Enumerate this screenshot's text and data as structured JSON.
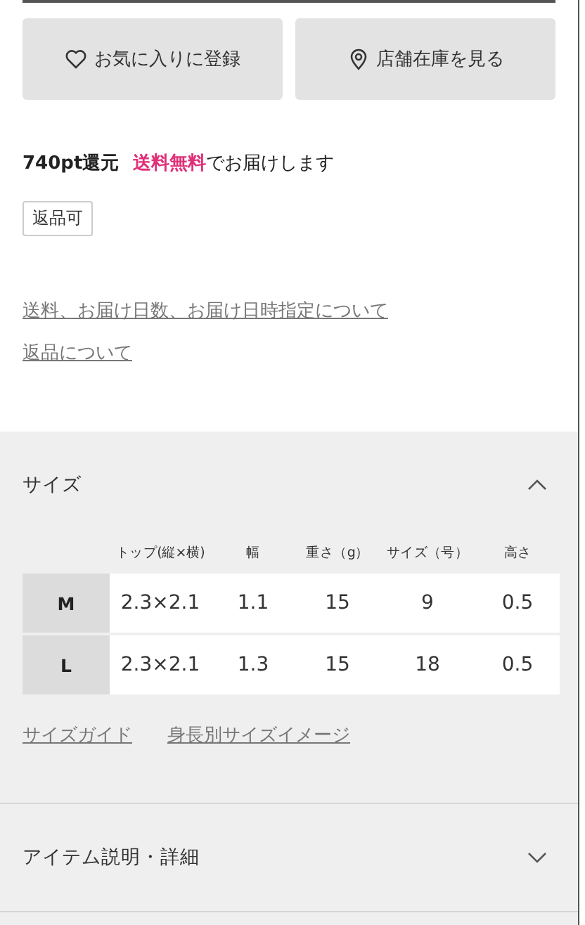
{
  "actions": [
    {
      "kind": "heart",
      "label": "お気に入りに登録"
    },
    {
      "kind": "pin",
      "label": "店舗在庫を見る"
    }
  ],
  "points": "740pt還元",
  "shipping": {
    "highlight": "送料無料",
    "text": "でお届けします"
  },
  "tag": "返品可",
  "links": [
    "送料、お届け日数、お届け日時指定について",
    "返品について"
  ],
  "size_section": {
    "title": "サイズ",
    "expanded": true,
    "table": {
      "columns": [
        "トップ(縦×横)",
        "幅",
        "重さ（g）",
        "サイズ（号）",
        "高さ"
      ],
      "rows": [
        {
          "label": "M",
          "cells": [
            "2.3×2.1",
            "1.1",
            "15",
            "9",
            "0.5"
          ]
        },
        {
          "label": "L",
          "cells": [
            "2.3×2.1",
            "1.3",
            "15",
            "18",
            "0.5"
          ]
        }
      ]
    },
    "links": [
      "サイズガイド",
      "身長別サイズイメージ"
    ]
  },
  "detail_section": {
    "title": "アイテム説明・詳細",
    "expanded": false
  }
}
